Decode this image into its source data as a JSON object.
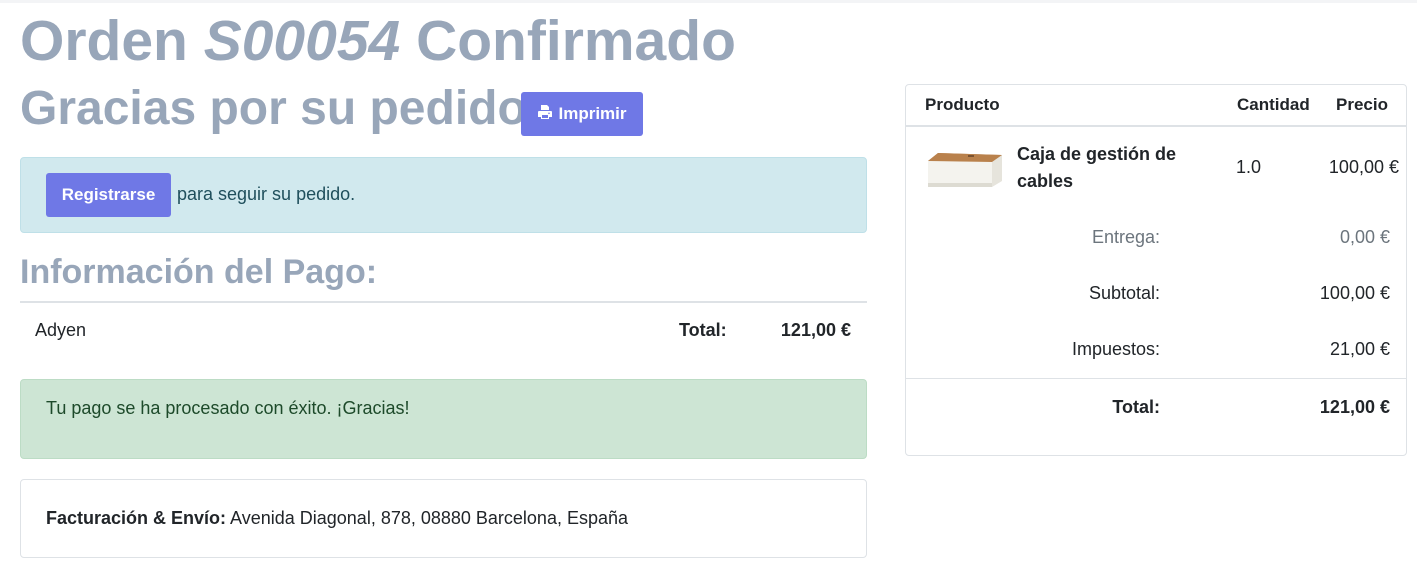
{
  "header": {
    "order_prefix": "Orden ",
    "order_number": "S00054",
    "order_status": " Confirmado",
    "thanks": "Gracias por su pedido.",
    "print_label": "Imprimir"
  },
  "signup": {
    "button_label": "Registrarse",
    "text": "para seguir su pedido."
  },
  "payment": {
    "title": "Información del Pago:",
    "method": "Adyen",
    "total_label": "Total:",
    "total_value": "121,00 €",
    "success_message": "Tu pago se ha procesado con éxito. ¡Gracias!"
  },
  "billing": {
    "label": "Facturación & Envío:",
    "address": " Avenida Diagonal, 878, 08880 Barcelona, España"
  },
  "summary": {
    "col_product": "Producto",
    "col_quantity": "Cantidad",
    "col_price": "Precio",
    "product_name": "Caja de gestión de cables",
    "product_qty": "1.0",
    "product_price": "100,00 €",
    "delivery_label": "Entrega:",
    "delivery_value": "0,00 €",
    "subtotal_label": "Subtotal:",
    "subtotal_value": "100,00 €",
    "taxes_label": "Impuestos:",
    "taxes_value": "21,00 €",
    "total_label": "Total:",
    "total_value": "121,00 €"
  },
  "colors": {
    "heading": "#98a6b9",
    "primary_button": "#6f78e6",
    "info_bg": "#d1e9ee",
    "success_bg": "#cde5d4"
  },
  "icons": {
    "print": "printer-icon"
  }
}
